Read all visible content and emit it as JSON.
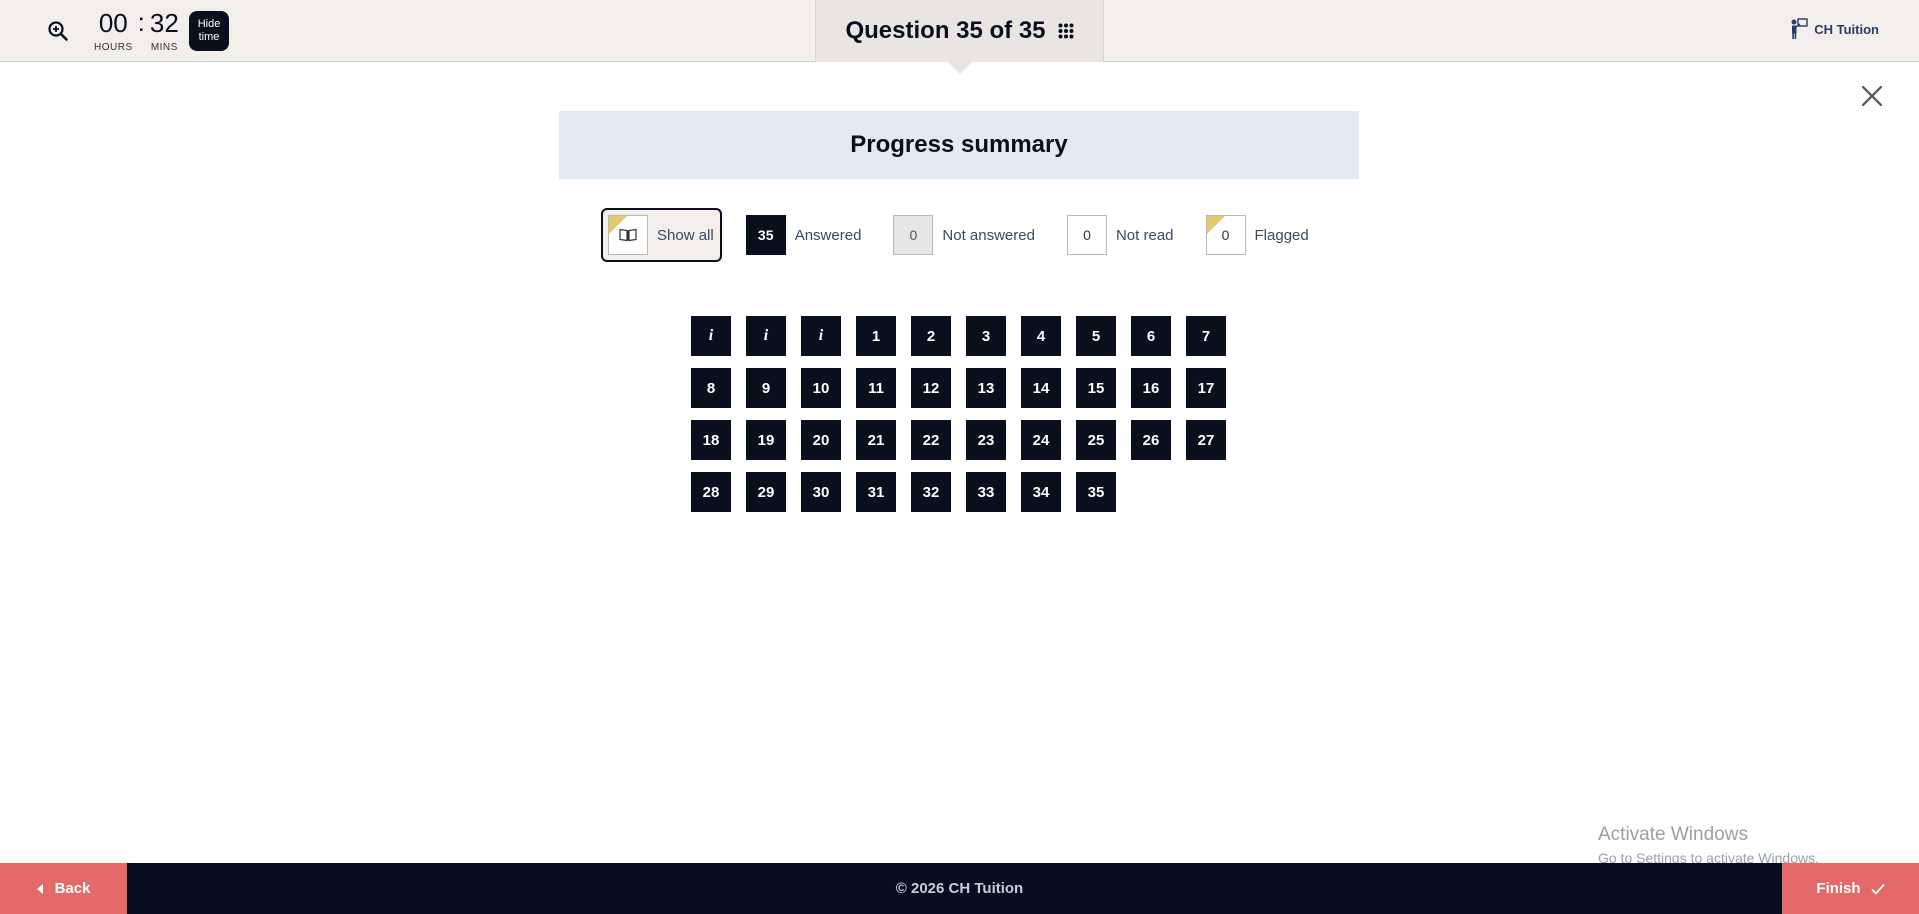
{
  "header": {
    "timer": {
      "hours": "00",
      "separator": ":",
      "mins": "32",
      "hours_label": "HOURS",
      "mins_label": "MINS"
    },
    "hide_time_line1": "Hide",
    "hide_time_line2": "time",
    "question_label": "Question 35 of 35",
    "brand": "CH Tuition"
  },
  "summary": {
    "title": "Progress summary",
    "filters": {
      "show_all": "Show all",
      "answered_count": "35",
      "answered_label": "Answered",
      "not_answered_count": "0",
      "not_answered_label": "Not answered",
      "not_read_count": "0",
      "not_read_label": "Not read",
      "flagged_count": "0",
      "flagged_label": "Flagged"
    },
    "questions": [
      "i",
      "i",
      "i",
      "1",
      "2",
      "3",
      "4",
      "5",
      "6",
      "7",
      "8",
      "9",
      "10",
      "11",
      "12",
      "13",
      "14",
      "15",
      "16",
      "17",
      "18",
      "19",
      "20",
      "21",
      "22",
      "23",
      "24",
      "25",
      "26",
      "27",
      "28",
      "29",
      "30",
      "31",
      "32",
      "33",
      "34",
      "35"
    ]
  },
  "watermark": {
    "line1": "Activate Windows",
    "line2": "Go to Settings to activate Windows."
  },
  "footer": {
    "back": "Back",
    "copyright": "© 2026 CH Tuition",
    "finish": "Finish"
  },
  "colors": {
    "accent": "#e46a6a",
    "dark": "#0a0f1e",
    "flag": "#e3c870"
  },
  "icons": {
    "zoom": "zoom-in-icon",
    "grid": "grid-icon",
    "close": "close-icon",
    "book": "book-icon",
    "check": "check-icon"
  }
}
